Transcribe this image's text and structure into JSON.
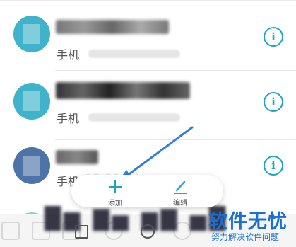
{
  "contacts": [
    {
      "phone_label": "手机",
      "phone_value": "",
      "avatar_color": "#3fb3c9"
    },
    {
      "phone_label": "手机",
      "phone_value": "",
      "avatar_color": "#3fb3c9"
    },
    {
      "phone_label": "手机",
      "phone_value": "15   50 64",
      "avatar_color": "#4d73a8"
    }
  ],
  "info_icon_glyph": "i",
  "popup": {
    "add_label": "添加",
    "edit_label": "编辑"
  },
  "watermark": {
    "title": "软件无忧",
    "subtitle": "努力解决软件问题"
  },
  "colors": {
    "accent": "#17a9c4",
    "arrow": "#2f80d8",
    "watermark": "#1a6fd0"
  }
}
